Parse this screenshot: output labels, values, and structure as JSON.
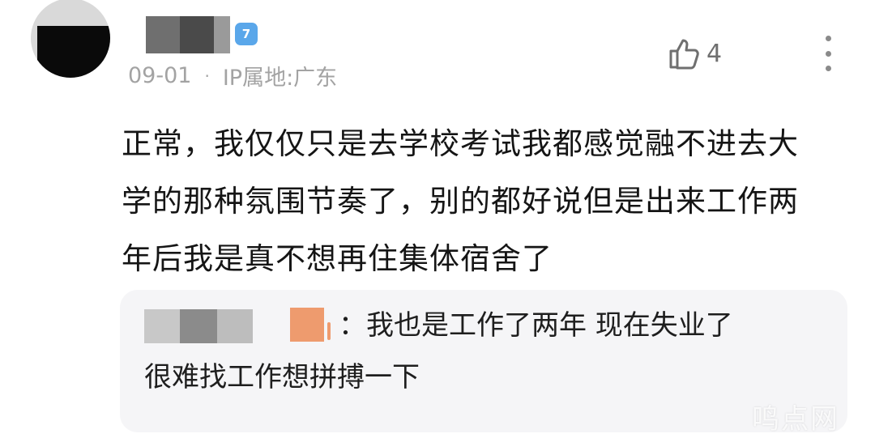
{
  "comment": {
    "level": "7",
    "date": "09-01",
    "separator": "·",
    "ip_location": "IP属地:广东",
    "like_count": "4",
    "body_lines": [
      "正常，我仅仅只是去学校考试我都感觉融不进去大",
      "学的那种氛围节奏了，别的都好说但是出来工作两",
      "年后我是真不想再住集体宿舍了"
    ]
  },
  "reply": {
    "separator": "：",
    "text_line1": "我也是工作了两年 现在失业了",
    "text_line2": "很难找工作想拼搏一下"
  },
  "watermark": "鸣点网",
  "colors": {
    "badge": "#5aa7ea",
    "meta_text": "#a3a3a3",
    "reply_bg": "#f5f5f7"
  },
  "icons": {
    "like": "thumbs-up-icon",
    "more": "more-vertical-icon"
  }
}
